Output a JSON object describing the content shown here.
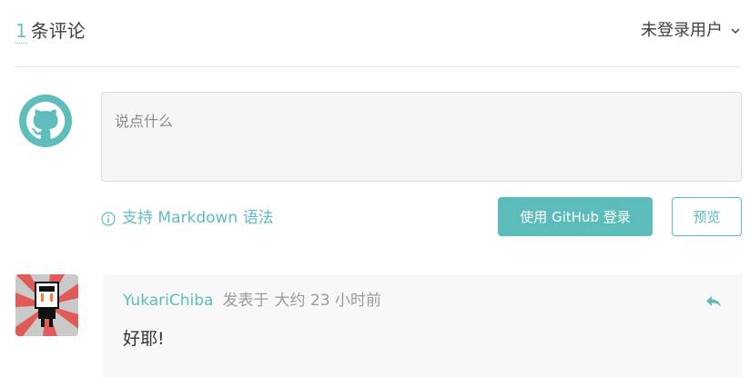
{
  "header": {
    "count": "1",
    "count_text": "条评论",
    "user_menu_label": "未登录用户",
    "user_menu_icon": "chevron-down-icon"
  },
  "editor": {
    "placeholder": "说点什么",
    "value": ""
  },
  "toolbar": {
    "markdown_tip": "支持 Markdown 语法",
    "login_label": "使用 GitHub 登录",
    "preview_label": "预览"
  },
  "comments": [
    {
      "author": "YukariChiba",
      "posted_label": "发表于",
      "time": "大约 23 小时前",
      "body": "好耶!"
    }
  ],
  "colors": {
    "accent": "#5cbcba",
    "editor_bg": "#f6f6f6",
    "comment_bg": "#f8f8f8"
  }
}
